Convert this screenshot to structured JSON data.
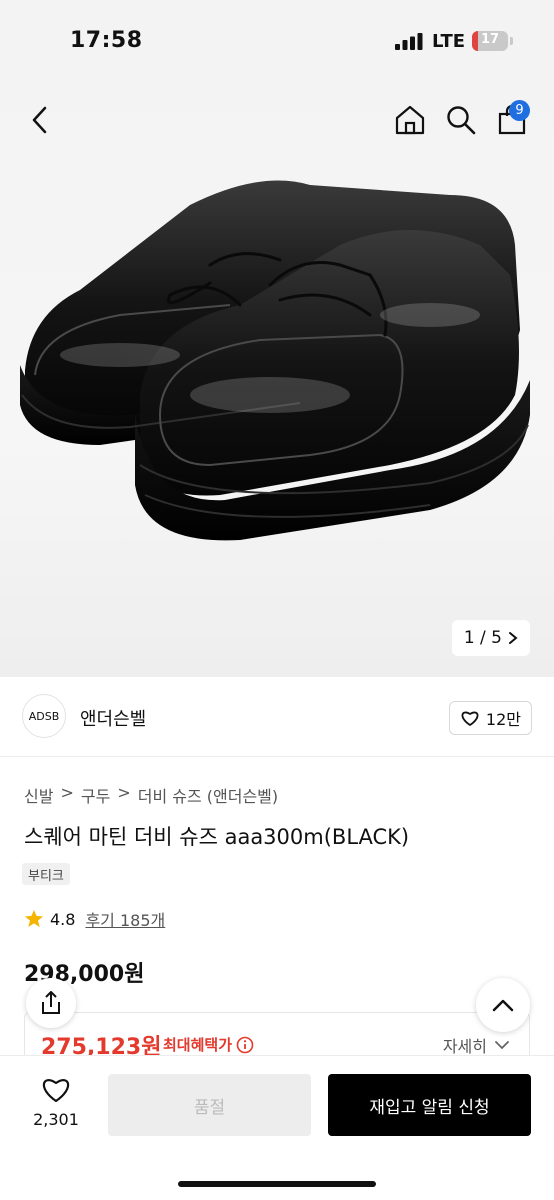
{
  "status_bar": {
    "time": "17:58",
    "network": "LTE",
    "battery": "17",
    "battery_level": 0.17
  },
  "header": {
    "icons": [
      "back-icon",
      "home-icon",
      "search-icon",
      "bag-icon"
    ],
    "cart_count": "9"
  },
  "gallery": {
    "pager": "1 / 5"
  },
  "brand": {
    "logo_text": "ADSB",
    "name": "앤더슨벨",
    "likes": "12만"
  },
  "breadcrumb": [
    "신발",
    "구두",
    "더비 슈즈 (앤더슨벨)"
  ],
  "product": {
    "title": "스퀘어 마틴 더비 슈즈 aaa300m(BLACK)",
    "tag": "부티크",
    "rating": "4.8",
    "review_link": "후기 185개",
    "price": "298,000원"
  },
  "benefit": {
    "price": "275,123원",
    "label": "최대혜택가",
    "more": "자세히"
  },
  "bottom_bar": {
    "wish_count": "2,301",
    "soldout_label": "품절",
    "restock_label": "재입고 알림 신청"
  },
  "colors": {
    "accent_red": "#e33a2d",
    "badge_blue": "#1f6fe0",
    "star": "#f4b400"
  }
}
